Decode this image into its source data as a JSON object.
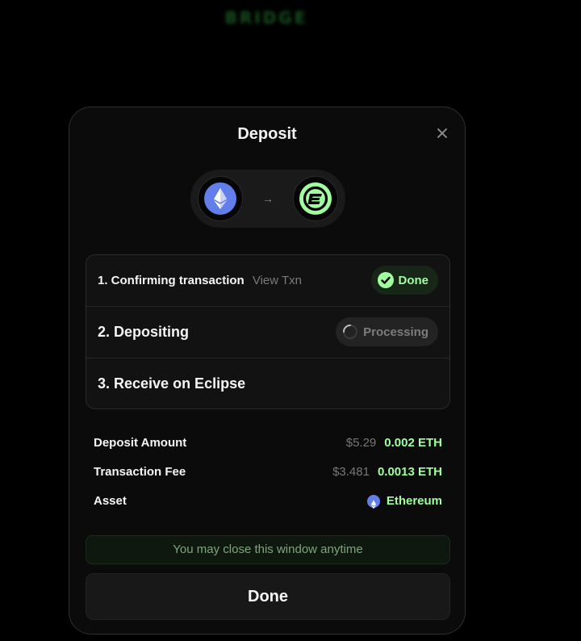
{
  "background": {
    "app_title": "BRIDGE"
  },
  "modal": {
    "title": "Deposit",
    "route": {
      "from_chain": "Ethereum",
      "to_chain": "Eclipse"
    },
    "steps": [
      {
        "label": "1. Confirming transaction",
        "link": "View Txn",
        "status": "Done"
      },
      {
        "label": "2. Depositing",
        "status": "Processing"
      },
      {
        "label": "3. Receive on Eclipse"
      }
    ],
    "summary": {
      "deposit_amount": {
        "label": "Deposit Amount",
        "usd": "$5.29",
        "amount": "0.002 ETH"
      },
      "transaction_fee": {
        "label": "Transaction Fee",
        "usd": "$3.481",
        "amount": "0.0013 ETH"
      },
      "asset": {
        "label": "Asset",
        "value": "Ethereum"
      }
    },
    "notice": "You may close this window anytime",
    "done_button": "Done"
  },
  "colors": {
    "accent_green": "#a1fea0",
    "eth_blue": "#627eea",
    "modal_bg": "#0b0b0b"
  },
  "icons": {
    "close": "close-icon",
    "arrow": "arrow-right-icon",
    "eth": "ethereum-icon",
    "eclipse": "eclipse-logo-icon",
    "check": "check-icon",
    "spinner": "spinner-icon"
  }
}
